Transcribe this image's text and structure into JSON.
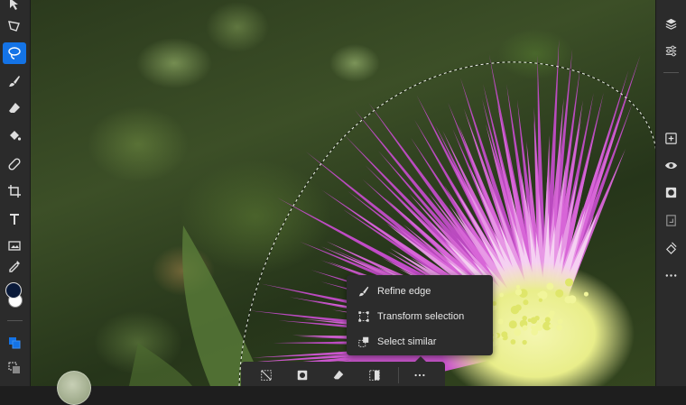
{
  "app": {
    "accent": "#1473e6",
    "toolbar_bg": "#2b2b2b",
    "menu_bg": "#2c2c2c"
  },
  "left_toolbar": {
    "tools": [
      "move-icon",
      "polygon-lasso-icon",
      "lasso-select-icon",
      "brush-icon",
      "eraser-icon",
      "paint-bucket-icon",
      "healing-icon",
      "crop-icon",
      "type-icon",
      "place-image-icon",
      "eyedropper-icon"
    ],
    "active": "lasso-select-icon",
    "foreground_color": "#0a1a3a",
    "background_color": "#ffffff"
  },
  "right_toolbar": {
    "tools": [
      "layers-icon",
      "adjustments-icon",
      "add-layer-icon",
      "visibility-icon",
      "mask-icon",
      "clip-icon",
      "fx-icon",
      "more-icon"
    ]
  },
  "context_menu": {
    "items": [
      {
        "icon": "refine-edge-icon",
        "label": "Refine edge"
      },
      {
        "icon": "transform-selection-icon",
        "label": "Transform selection"
      },
      {
        "icon": "select-similar-icon",
        "label": "Select similar"
      }
    ]
  },
  "taskbar": {
    "buttons": [
      "deselect-icon",
      "mask-selection-icon",
      "erase-selection-icon",
      "invert-selection-icon",
      "more-options-icon"
    ]
  }
}
